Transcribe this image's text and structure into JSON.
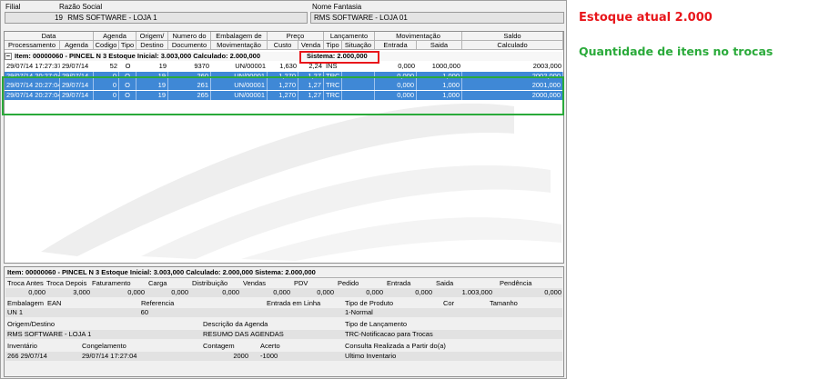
{
  "header": {
    "filial_label": "Filial",
    "razao_label": "Razão Social",
    "filial_value": "19",
    "razao_value": "RMS SOFTWARE - LOJA 1",
    "fantasia_label": "Nome Fantasia",
    "fantasia_value": "RMS SOFTWARE - LOJA 01"
  },
  "grid": {
    "header_top": [
      "Data",
      "Agenda",
      "Origem/",
      "Numero do",
      "Embalagem de",
      "Preço",
      "Lançamento",
      "Movimentação",
      "Saldo"
    ],
    "header_bottom": [
      "Processamento",
      "Agenda",
      "Codigo",
      "Tipo",
      "Destino",
      "Documento",
      "Movimentação",
      "Custo",
      "Venda",
      "Tipo",
      "Situação",
      "Entrada",
      "Saida",
      "Calculado"
    ],
    "item_line": "Item: 00000060 - PINCEL N 3  Estoque Inicial: 3.003,000  Calculado: 2.000,000",
    "item_sistema": "Sistema: 2.000,000",
    "expand_symbol": "−",
    "rows": [
      {
        "proc": "29/07/14 17:27:37",
        "agenda": "29/07/14",
        "codigo": "52",
        "tipo": "O",
        "destino": "19",
        "documento": "9370",
        "emb": "UN/00001",
        "custo": "1,630",
        "venda": "2,24",
        "lanc_tipo": "INS",
        "situacao": "",
        "entrada": "0,000",
        "saida": "1000,000",
        "calculado": "2003,000",
        "selected": false
      },
      {
        "proc": "29/07/14 20:27:04",
        "agenda": "29/07/14",
        "codigo": "0",
        "tipo": "O",
        "destino": "19",
        "documento": "260",
        "emb": "UN/00001",
        "custo": "1,270",
        "venda": "1,27",
        "lanc_tipo": "TRC",
        "situacao": "",
        "entrada": "0,000",
        "saida": "1,000",
        "calculado": "2002,000",
        "selected": true
      },
      {
        "proc": "29/07/14 20:27:04",
        "agenda": "29/07/14",
        "codigo": "0",
        "tipo": "O",
        "destino": "19",
        "documento": "261",
        "emb": "UN/00001",
        "custo": "1,270",
        "venda": "1,27",
        "lanc_tipo": "TRC",
        "situacao": "",
        "entrada": "0,000",
        "saida": "1,000",
        "calculado": "2001,000",
        "selected": true
      },
      {
        "proc": "29/07/14 20:27:04",
        "agenda": "29/07/14",
        "codigo": "0",
        "tipo": "O",
        "destino": "19",
        "documento": "265",
        "emb": "UN/00001",
        "custo": "1,270",
        "venda": "1,27",
        "lanc_tipo": "TRC",
        "situacao": "",
        "entrada": "0,000",
        "saida": "1,000",
        "calculado": "2000,000",
        "selected": true
      }
    ]
  },
  "detail": {
    "item_line": "Item: 00000060 - PINCEL N 3  Estoque Inicial: 3.003,000  Calculado: 2.000,000  Sistema: 2.000,000",
    "totals_labels": [
      "Troca Antes",
      "Troca Depois",
      "Faturamento",
      "Carga",
      "Distribuição",
      "Vendas",
      "PDV",
      "Pedido",
      "Entrada",
      "Saida",
      "Pendência"
    ],
    "totals_values": [
      "0,000",
      "3,000",
      "0,000",
      "0,000",
      "0,000",
      "0,000",
      "0,000",
      "0,000",
      "0,000",
      "1.003,000",
      "0,000"
    ],
    "emb_label": "Embalagem",
    "ean_label": "EAN",
    "ref_label": "Referencia",
    "entrada_linha_label": "Entrada em Linha",
    "tipo_prod_label": "Tipo de Produto",
    "cor_label": "Cor",
    "tamanho_label": "Tamanho",
    "emb_value": "UN  1",
    "ean_value": "60",
    "tipo_prod_value": "1-Normal",
    "origem_label": "Origem/Destino",
    "desc_agenda_label": "Descrição da Agenda",
    "tipo_lanc_label": "Tipo de Lançamento",
    "origem_value": "RMS SOFTWARE - LOJA 1",
    "desc_agenda_value": "RESUMO DAS AGENDAS",
    "tipo_lanc_value": "TRC-Notificacao para Trocas",
    "inventario_label": "Inventário",
    "congelamento_label": "Congelamento",
    "contagem_label": "Contagem",
    "acerto_label": "Acerto",
    "consulta_label": "Consulta Realizada a Partir do(a)",
    "inventario_value": "266 29/07/14",
    "congelamento_value": "29/07/14 17:27:04",
    "contagem_value": "2000",
    "acerto_value": "-1000",
    "consulta_value": "Ultimo Inventario"
  },
  "annotations": {
    "estoque": "Estoque atual 2.000",
    "trocas": "Quantidade de itens no trocas"
  },
  "colors": {
    "red": "#e8161b",
    "green": "#2aaa3a",
    "selection": "#3f88d6"
  }
}
